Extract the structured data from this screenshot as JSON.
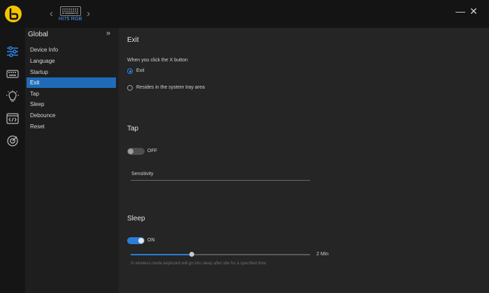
{
  "header": {
    "device_name": "HI75 RGB",
    "prev_label": "‹",
    "next_label": "›",
    "minimize_label": "—",
    "close_label": "✕"
  },
  "sidebar_icons": [
    "sliders-icon",
    "keyboard-icon",
    "lightbulb-icon",
    "macro-icon",
    "target-icon"
  ],
  "nav": {
    "title": "Global",
    "collapse_label": "»",
    "items": [
      "Device Info",
      "Language",
      "Startup",
      "Exit",
      "Tap",
      "Sleep",
      "Debounce",
      "Reset"
    ],
    "active": "Exit"
  },
  "exit": {
    "title": "Exit",
    "prompt": "When you click the X button",
    "option_exit": "Exit",
    "option_tray": "Resides in the system tray area",
    "selected": "Exit"
  },
  "tap": {
    "title": "Tap",
    "toggle_label": "OFF",
    "toggle_on": false,
    "sensitivity_label": "Sensitivity"
  },
  "sleep": {
    "title": "Sleep",
    "toggle_label": "ON",
    "toggle_on": true,
    "slider_fraction": 0.34,
    "slider_value": "2 Min",
    "hint": "In wireless mode,keyboard will go into sleep after idle for a specified time"
  },
  "colors": {
    "accent": "#2a7ed6",
    "logo": "#f5c400",
    "device_label": "#4aa3ff"
  }
}
